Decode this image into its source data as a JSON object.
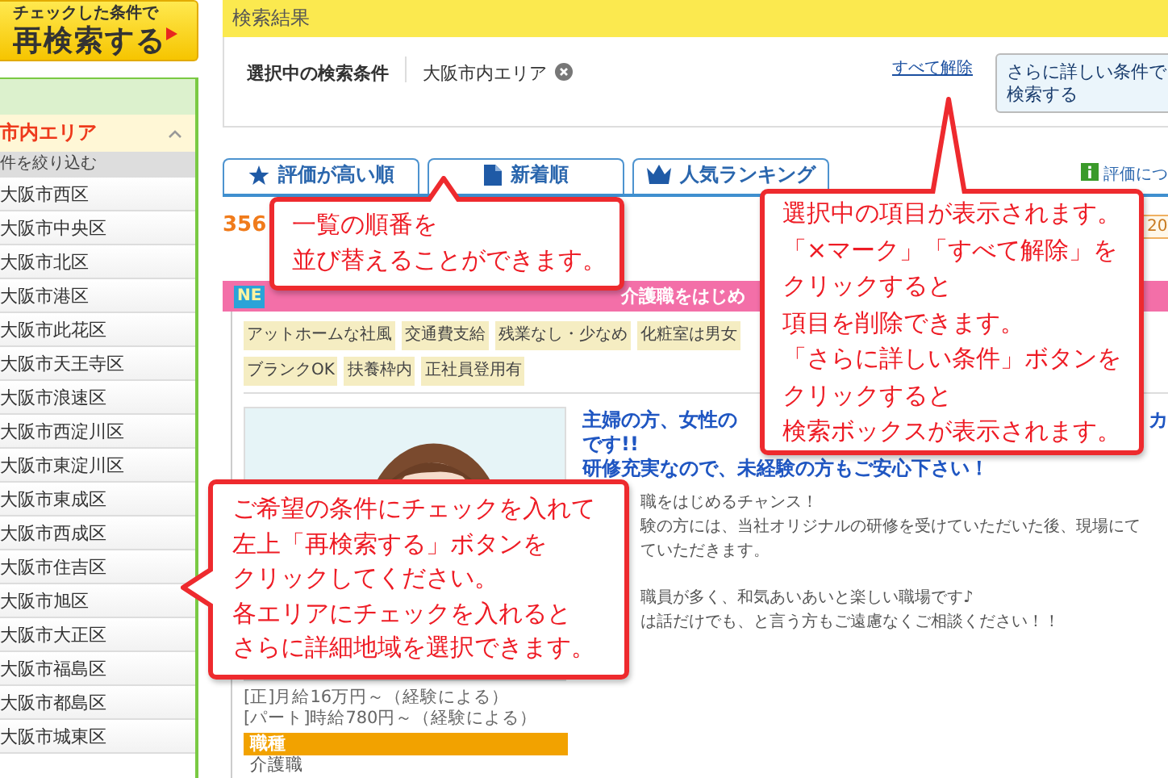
{
  "sidebar": {
    "research_button": {
      "caption": "チェックした条件で",
      "label": "再検索する"
    },
    "area": {
      "label": "市内エリア",
      "expanded": true
    },
    "filter_label": "件を絞り込む",
    "items": [
      "大阪市西区",
      "大阪市中央区",
      "大阪市北区",
      "大阪市港区",
      "大阪市此花区",
      "大阪市天王寺区",
      "大阪市浪速区",
      "大阪市西淀川区",
      "大阪市東淀川区",
      "大阪市東成区",
      "大阪市西成区",
      "大阪市住吉区",
      "大阪市旭区",
      "大阪市大正区",
      "大阪市福島区",
      "大阪市都島区",
      "大阪市城東区"
    ]
  },
  "results": {
    "title": "検索結果",
    "conditions_label": "選択中の検索条件",
    "conditions": [
      {
        "label": "大阪市内エリア"
      }
    ],
    "clear_all": "すべて解除",
    "detail_button": [
      "さらに詳しい条件で",
      "検索する"
    ]
  },
  "sort_tabs": [
    {
      "label": "評価が高い順"
    },
    {
      "label": "新着順"
    },
    {
      "label": "人気ランキング"
    }
  ],
  "rating_link": "評価につ",
  "count": "356",
  "per_page": "20",
  "job": {
    "badge": "NE",
    "title": "介護職をはじめ",
    "tags": [
      [
        "アットホームな社風",
        "交通費支給",
        "残業なし・少なめ",
        "化粧室は男女"
      ],
      [
        "ブランクOK",
        "扶養枠内",
        "正社員登用有"
      ]
    ],
    "heading_start": "主婦の方、女性の",
    "heading_end": "カ",
    "heading_lines": [
      "です!!",
      "研修充実なので、未経験の方もご安心下さい！"
    ],
    "body": [
      [
        "職をはじめるチャンス！",
        "験の方には、当社オリジナルの研修を受けていただいた後、現場にて",
        "ていただきます。"
      ],
      [
        "職員が多く、和気あいあいと楽しい職場です♪",
        "は話だけでも、と言う方もご遠慮なくご相談ください！！"
      ]
    ],
    "salary": [
      "[正]月給16万円～（経験による）",
      "[パート]時給780円～（経験による）"
    ],
    "job_type_label": "職種",
    "job_type": "介護職"
  },
  "callouts": [
    {
      "lines": [
        "一覧の順番を",
        "並び替えることができます。"
      ]
    },
    {
      "lines": [
        "選択中の項目が表示されます。",
        "「×マーク」「すべて解除」を",
        "クリックすると",
        "項目を削除できます。",
        "「さらに詳しい条件」ボタンを",
        "クリックすると",
        "検索ボックスが表示されます。"
      ]
    },
    {
      "lines": [
        "ご希望の条件にチェックを入れて",
        "左上「再検索する」ボタンを",
        "クリックしてください。",
        "各エリアにチェックを入れると",
        "さらに詳細地域を選択できます。"
      ]
    }
  ]
}
